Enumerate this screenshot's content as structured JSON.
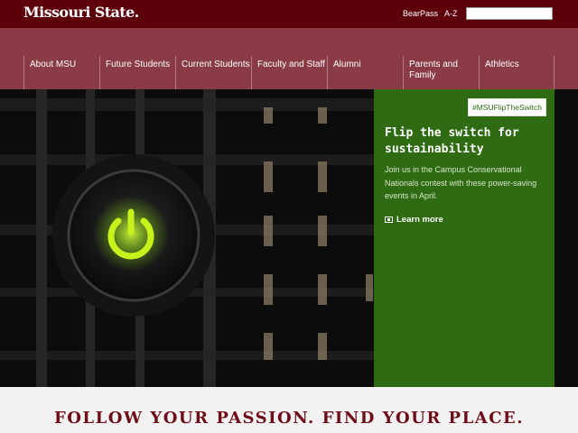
{
  "header": {
    "logo_text": "Missouri State.",
    "links": [
      "BearPass",
      "A-Z"
    ],
    "search_placeholder": ""
  },
  "nav": {
    "items": [
      {
        "label": "About MSU"
      },
      {
        "label": "Future Students"
      },
      {
        "label": "Current Students"
      },
      {
        "label": "Faculty and Staff"
      },
      {
        "label": "Alumni"
      },
      {
        "label": "Parents and Family"
      },
      {
        "label": "Athletics"
      }
    ]
  },
  "hero": {
    "image_icon": "power-button-icon",
    "hashtag": "#MSUFlipTheSwitch",
    "title": "Flip the switch for sustainability",
    "text": "Join us in the Campus Conservational Nationals contest with these power-saving events in April.",
    "link_label": "Learn more",
    "accent_color": "#2e6b12"
  },
  "tagline": "FOLLOW YOUR PASSION. FIND YOUR PLACE.",
  "colors": {
    "maroon": "#5e0009",
    "nav": "#8a3b46",
    "tagline": "#6e0d18"
  }
}
